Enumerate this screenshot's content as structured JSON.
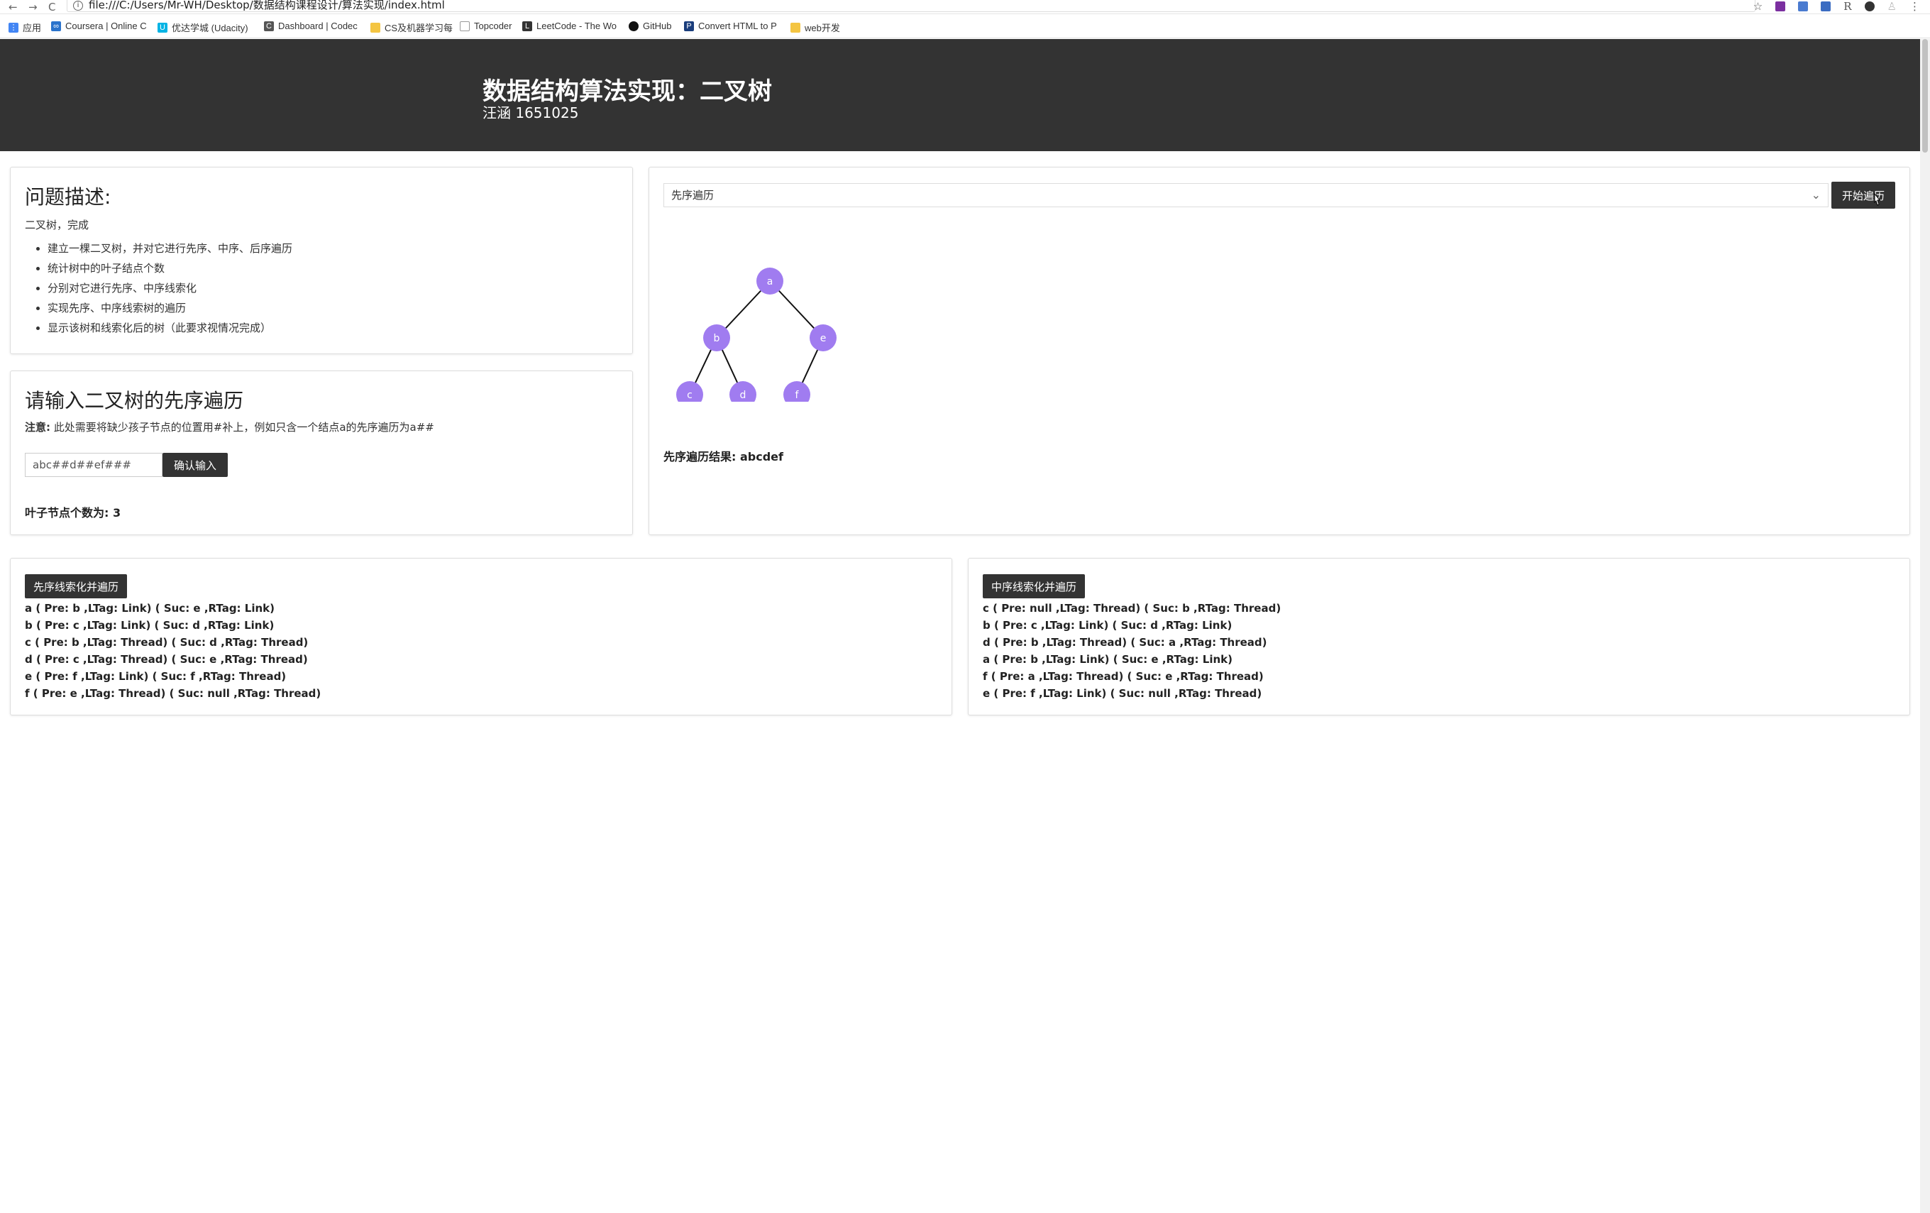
{
  "browser": {
    "url": "file:///C:/Users/Mr-WH/Desktop/数据结构课程设计/算法实现/index.html",
    "nav_back": "←",
    "nav_forward": "→",
    "nav_reload": "C",
    "extension_r": "R",
    "bookmarks": [
      {
        "label": "应用",
        "icon": "apps-icon",
        "color": "#4285f4"
      },
      {
        "label": "Coursera | Online C",
        "icon": "coursera-icon",
        "color": "#2a73cc"
      },
      {
        "label": "优达学城 (Udacity)",
        "icon": "udacity-icon",
        "color": "#02b3e4"
      },
      {
        "label": "Dashboard | Codec",
        "icon": "codecademy-icon",
        "color": "#555555"
      },
      {
        "label": "CS及机器学习每",
        "icon": "folder-icon",
        "color": "#f4c542"
      },
      {
        "label": "Topcoder",
        "icon": "page-icon",
        "color": "#999999"
      },
      {
        "label": "LeetCode - The Wo",
        "icon": "leetcode-icon",
        "color": "#333333"
      },
      {
        "label": "GitHub",
        "icon": "github-icon",
        "color": "#111111"
      },
      {
        "label": "Convert HTML to P",
        "icon": "convert-icon",
        "color": "#1a3d7c"
      },
      {
        "label": "web开发",
        "icon": "folder-icon",
        "color": "#f4c542"
      }
    ]
  },
  "header": {
    "title": "数据结构算法实现：二叉树",
    "subtitle": "汪涵 1651025"
  },
  "problem": {
    "title": "问题描述:",
    "intro": "二叉树，完成",
    "items": [
      "建立一棵二叉树，并对它进行先序、中序、后序遍历",
      "统计树中的叶子结点个数",
      "分别对它进行先序、中序线索化",
      "实现先序、中序线索树的遍历",
      "显示该树和线索化后的树（此要求视情况完成）"
    ]
  },
  "input": {
    "title": "请输入二叉树的先序遍历",
    "note_label": "注意:",
    "note_text": "此处需要将缺少孩子节点的位置用#补上，例如只含一个结点a的先序遍历为a##",
    "value": "abc##d##ef###",
    "confirm_label": "确认输入",
    "leaf_label": "叶子节点个数为:",
    "leaf_count": "3"
  },
  "traversal": {
    "selected": "先序遍历",
    "start_label": "开始遍历",
    "result_label": "先序遍历结果:",
    "result_value": "abcdef",
    "node_color": "#a07cf0"
  },
  "tree": {
    "nodes": [
      {
        "id": "a",
        "label": "a"
      },
      {
        "id": "b",
        "label": "b"
      },
      {
        "id": "e",
        "label": "e"
      },
      {
        "id": "c",
        "label": "c"
      },
      {
        "id": "d",
        "label": "d"
      },
      {
        "id": "f",
        "label": "f"
      }
    ],
    "edges": [
      [
        "a",
        "b"
      ],
      [
        "a",
        "e"
      ],
      [
        "b",
        "c"
      ],
      [
        "b",
        "d"
      ],
      [
        "e",
        "f"
      ]
    ]
  },
  "pre_thread": {
    "button": "先序线索化并遍历",
    "lines": [
      "a ( Pre: b ,LTag: Link) ( Suc: e ,RTag: Link)",
      "b ( Pre: c ,LTag: Link) ( Suc: d ,RTag: Link)",
      "c ( Pre: b ,LTag: Thread) ( Suc: d ,RTag: Thread)",
      "d ( Pre: c ,LTag: Thread) ( Suc: e ,RTag: Thread)",
      "e ( Pre: f ,LTag: Link) ( Suc: f ,RTag: Thread)",
      "f ( Pre: e ,LTag: Thread) ( Suc: null ,RTag: Thread)"
    ]
  },
  "in_thread": {
    "button": "中序线索化并遍历",
    "lines": [
      "c ( Pre: null ,LTag: Thread) ( Suc: b ,RTag: Thread)",
      "b ( Pre: c ,LTag: Link) ( Suc: d ,RTag: Link)",
      "d ( Pre: b ,LTag: Thread) ( Suc: a ,RTag: Thread)",
      "a ( Pre: b ,LTag: Link) ( Suc: e ,RTag: Link)",
      "f ( Pre: a ,LTag: Thread) ( Suc: e ,RTag: Thread)",
      "e ( Pre: f ,LTag: Link) ( Suc: null ,RTag: Thread)"
    ]
  }
}
